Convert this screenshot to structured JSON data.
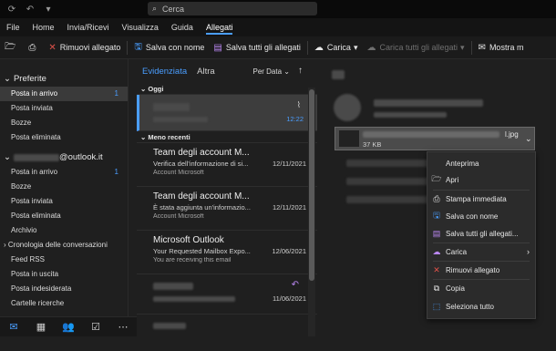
{
  "titlebar": {
    "search_placeholder": "Cerca"
  },
  "menu": [
    "File",
    "Home",
    "Invia/Ricevi",
    "Visualizza",
    "Guida",
    "Allegati"
  ],
  "ribbon": {
    "remove": "Rimuovi allegato",
    "save_as": "Salva con nome",
    "save_all": "Salva tutti gli allegati",
    "upload": "Carica",
    "upload_all": "Carica tutti gli allegati",
    "show_more": "Mostra m"
  },
  "sidebar": {
    "favorites_title": "Preferite",
    "favorites": [
      {
        "label": "Posta in arrivo",
        "count": "1"
      },
      {
        "label": "Posta inviata",
        "count": ""
      },
      {
        "label": "Bozze",
        "count": ""
      },
      {
        "label": "Posta eliminata",
        "count": ""
      }
    ],
    "account_suffix": "@outlook.it",
    "folders": [
      {
        "label": "Posta in arrivo",
        "count": "1"
      },
      {
        "label": "Bozze",
        "count": ""
      },
      {
        "label": "Posta inviata",
        "count": ""
      },
      {
        "label": "Posta eliminata",
        "count": ""
      },
      {
        "label": "Archivio",
        "count": ""
      },
      {
        "label": "Cronologia delle conversazioni",
        "count": ""
      },
      {
        "label": "Feed RSS",
        "count": ""
      },
      {
        "label": "Posta in uscita",
        "count": ""
      },
      {
        "label": "Posta indesiderata",
        "count": ""
      },
      {
        "label": "Cartelle ricerche",
        "count": ""
      }
    ]
  },
  "messages": {
    "tab_focused": "Evidenziata",
    "tab_other": "Altra",
    "sort": "Per Data",
    "group_today": "Oggi",
    "group_older": "Meno recenti",
    "today_time": "12:22",
    "items": [
      {
        "from": "Team degli account M...",
        "subject": "Verifica dell'informazione di si...",
        "preview": "Account Microsoft",
        "date": "12/11/2021"
      },
      {
        "from": "Team degli account M...",
        "subject": "È stata aggiunta un'informazio...",
        "preview": "Account Microsoft",
        "date": "12/11/2021"
      },
      {
        "from": "Microsoft Outlook",
        "subject": "Your Requested Mailbox Expo...",
        "preview": "You are receiving this email",
        "date": "12/06/2021"
      }
    ],
    "last_date": "11/06/2021"
  },
  "attachment": {
    "ext": "l.jpg",
    "size": "37 KB"
  },
  "context_menu": [
    {
      "label": "Anteprima",
      "icon": "preview-icon"
    },
    {
      "label": "Apri",
      "icon": "folder-open-icon"
    },
    {
      "label": "Stampa immediata",
      "icon": "print-icon"
    },
    {
      "label": "Salva con nome",
      "icon": "save-icon"
    },
    {
      "label": "Salva tutti gli allegati...",
      "icon": "save-all-icon"
    },
    {
      "label": "Carica",
      "icon": "cloud-upload-icon"
    },
    {
      "label": "Rimuovi allegato",
      "icon": "remove-icon"
    },
    {
      "label": "Copia",
      "icon": "copy-icon"
    },
    {
      "label": "Seleziona tutto",
      "icon": "select-all-icon"
    }
  ],
  "colors": {
    "accent": "#4a9eff",
    "remove": "#e0524a"
  }
}
